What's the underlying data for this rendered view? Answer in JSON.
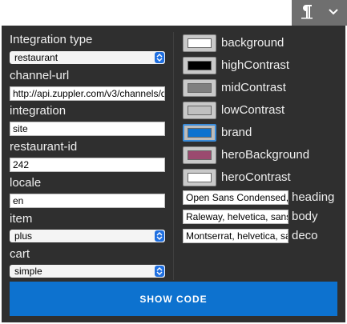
{
  "toolbar": {
    "icons": [
      "pilcrow-icon",
      "chevron-down-icon"
    ]
  },
  "left": {
    "integration_type": {
      "label": "Integration type",
      "value": "restaurant"
    },
    "channel_url": {
      "label": "channel-url",
      "value": "http://api.zuppler.com/v3/channels/d"
    },
    "integration": {
      "label": "integration",
      "value": "site"
    },
    "restaurant_id": {
      "label": "restaurant-id",
      "value": "242"
    },
    "locale": {
      "label": "locale",
      "value": "en"
    },
    "item": {
      "label": "item",
      "value": "plus"
    },
    "cart": {
      "label": "cart",
      "value": "simple"
    }
  },
  "colors": [
    {
      "label": "background",
      "hex": "#ffffff"
    },
    {
      "label": "highContrast",
      "hex": "#000000"
    },
    {
      "label": "midContrast",
      "hex": "#808080"
    },
    {
      "label": "lowContrast",
      "hex": "#c0c0c0"
    },
    {
      "label": "brand",
      "hex": "#0d72cf"
    },
    {
      "label": "heroBackground",
      "hex": "#9b4a6f"
    },
    {
      "label": "heroContrast",
      "hex": "#ffffff"
    }
  ],
  "fonts": [
    {
      "label": "heading",
      "value": "Open Sans Condensed,"
    },
    {
      "label": "body",
      "value": "Raleway, helvetica, sans"
    },
    {
      "label": "deco",
      "value": "Montserrat, helvetica, sa"
    }
  ],
  "show_code_label": "SHOW CODE"
}
